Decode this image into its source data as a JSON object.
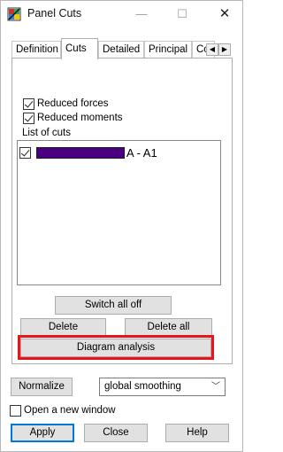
{
  "window": {
    "title": "Panel Cuts",
    "icon": "panel-cuts-app-icon",
    "minimize_glyph": "—",
    "maximize_glyph": "☐",
    "close_glyph": "✕"
  },
  "tabs": [
    {
      "label": "Definition",
      "active": false
    },
    {
      "label": "Cuts",
      "active": true
    },
    {
      "label": "Detailed",
      "active": false
    },
    {
      "label": "Principal",
      "active": false
    },
    {
      "label": "Co",
      "active": false
    }
  ],
  "tab_scroll": {
    "left_glyph": "◀",
    "right_glyph": "▶"
  },
  "cuts": {
    "reduced_forces": {
      "label": "Reduced forces",
      "checked": true
    },
    "reduced_moments": {
      "label": "Reduced moments",
      "checked": true
    },
    "list_label": "List of cuts",
    "items": [
      {
        "checked": true,
        "color": "#4b0082",
        "label": "A - A1"
      }
    ],
    "switch_all_off_label": "Switch all off",
    "delete_label": "Delete",
    "delete_all_label": "Delete all",
    "diagram_analysis_label": "Diagram analysis"
  },
  "bottom": {
    "normalize_label": "Normalize",
    "smoothing_value": "global smoothing",
    "open_new_window": {
      "label": "Open a new window",
      "checked": false
    },
    "apply_label": "Apply",
    "close_label": "Close",
    "help_label": "Help"
  },
  "colors": {
    "highlight": "#e8141b",
    "cut_color": "#4b0082",
    "primary_border": "#0078d7"
  }
}
